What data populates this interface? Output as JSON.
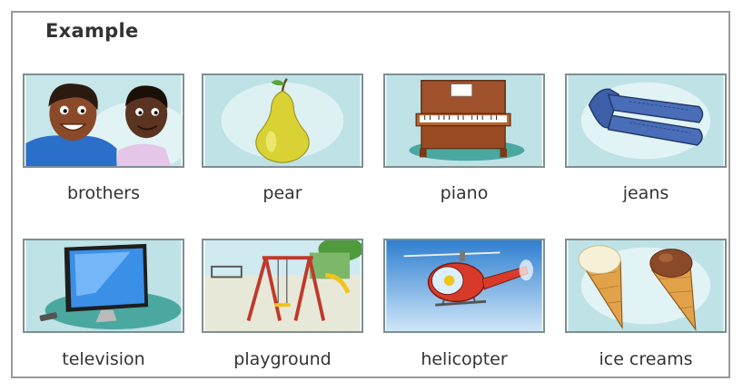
{
  "heading": "Example",
  "items": [
    {
      "label": "brothers"
    },
    {
      "label": "pear"
    },
    {
      "label": "piano"
    },
    {
      "label": "jeans"
    },
    {
      "label": "television"
    },
    {
      "label": "playground"
    },
    {
      "label": "helicopter"
    },
    {
      "label": "ice creams"
    }
  ]
}
